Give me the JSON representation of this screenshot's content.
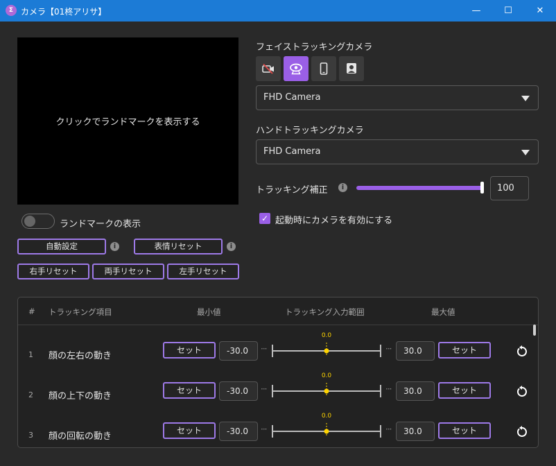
{
  "window": {
    "app_icon_text": "Σ",
    "title": "カメラ【01柊アリサ】",
    "minimize": "—",
    "maximize": "☐",
    "close": "✕"
  },
  "preview": {
    "text": "クリックでランドマークを表示する"
  },
  "landmark_toggle": {
    "label": "ランドマークの表示",
    "on": false
  },
  "buttons": {
    "auto_setup": "自動設定",
    "expression_reset": "表情リセット",
    "right_hand_reset": "右手リセット",
    "both_hands_reset": "両手リセット",
    "left_hand_reset": "左手リセット"
  },
  "face_camera": {
    "label": "フェイストラッキングカメラ",
    "sources": [
      {
        "icon": "camera-off-icon",
        "active": false
      },
      {
        "icon": "webcam-icon",
        "active": true
      },
      {
        "icon": "smartphone-icon",
        "active": false
      },
      {
        "icon": "person-camera-icon",
        "active": false
      }
    ],
    "selected": "FHD Camera"
  },
  "hand_camera": {
    "label": "ハンドトラッキングカメラ",
    "selected": "FHD Camera"
  },
  "tracking_correction": {
    "label": "トラッキング補正",
    "value": "100",
    "fraction": 1.0
  },
  "enable_on_start": {
    "label": "起動時にカメラを有効にする",
    "checked": true
  },
  "table": {
    "headers": {
      "index": "#",
      "item": "トラッキング項目",
      "min": "最小値",
      "range": "トラッキング入力範囲",
      "max": "最大値"
    },
    "set_label": "セット",
    "rows": [
      {
        "index": "1",
        "name": "顔の左右の動き",
        "min": "-30.0",
        "max": "30.0",
        "current": "0.0"
      },
      {
        "index": "2",
        "name": "顔の上下の動き",
        "min": "-30.0",
        "max": "30.0",
        "current": "0.0"
      },
      {
        "index": "3",
        "name": "顔の回転の動き",
        "min": "-30.0",
        "max": "30.0",
        "current": "0.0"
      }
    ]
  },
  "colors": {
    "accent": "#9a5fe6",
    "titlebar": "#1c7bd6",
    "indicator": "#ffd400"
  }
}
